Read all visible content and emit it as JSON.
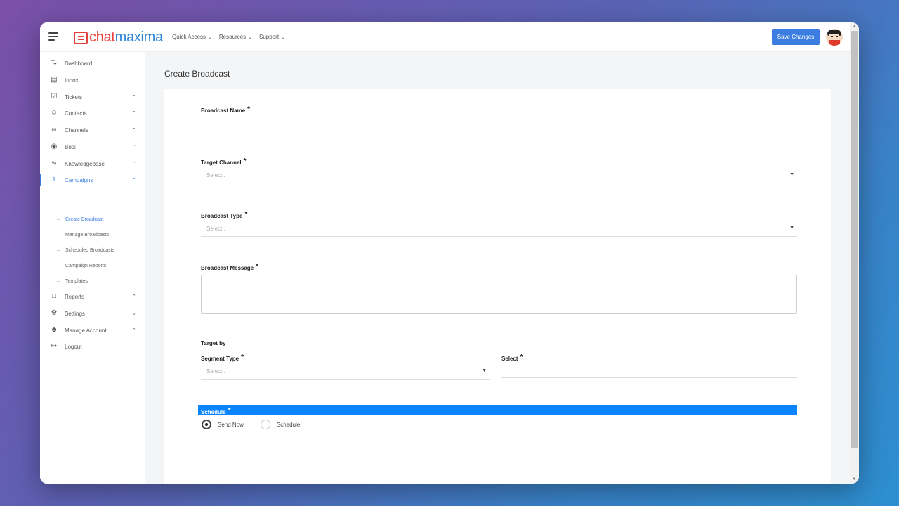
{
  "header": {
    "logo_chat": "chat",
    "logo_maxima": "maxima",
    "nav": [
      {
        "label": "Quick Access"
      },
      {
        "label": "Resources"
      },
      {
        "label": "Support"
      }
    ],
    "save_label": "Save Changes"
  },
  "sidebar": {
    "items": [
      {
        "label": "Dashboard",
        "icon": "sliders-icon"
      },
      {
        "label": "Inbox",
        "icon": "inbox-icon"
      },
      {
        "label": "Tickets",
        "icon": "checkbox-icon"
      },
      {
        "label": "Contacts",
        "icon": "users-icon"
      },
      {
        "label": "Channels",
        "icon": "link-icon"
      },
      {
        "label": "Bots",
        "icon": "bot-icon"
      },
      {
        "label": "Knowledgebase",
        "icon": "feed-icon"
      },
      {
        "label": "Campaigns",
        "icon": "broadcast-icon"
      },
      {
        "label": "Reports",
        "icon": "document-icon"
      },
      {
        "label": "Settings",
        "icon": "gear-icon"
      },
      {
        "label": "Manage Account",
        "icon": "user-icon"
      },
      {
        "label": "Logout",
        "icon": "logout-icon"
      }
    ],
    "campaign_subitems": [
      {
        "label": "Create Broadcast"
      },
      {
        "label": "Manage Broadcasts"
      },
      {
        "label": "Scheduled Broadcasts"
      },
      {
        "label": "Campaign Reports"
      },
      {
        "label": "Templates"
      }
    ]
  },
  "main": {
    "page_title": "Create Broadcast",
    "broadcast_name_label": "Broadcast Name",
    "target_channel_label": "Target Channel",
    "broadcast_type_label": "Broadcast Type",
    "broadcast_message_label": "Broadcast Message",
    "target_by_label": "Target by",
    "segment_type_label": "Segment Type",
    "select_label": "Select",
    "schedule_label": "Schedule",
    "select_placeholder": "Select..",
    "required_mark": "*",
    "radio_send_now": "Send Now",
    "radio_schedule": "Schedule"
  },
  "colors": {
    "accent": "#3b7de0",
    "schedule_bar": "#0a84ff",
    "input_focus": "#2ba88a",
    "logo_red": "#e8403c",
    "logo_blue": "#2f86d6"
  }
}
